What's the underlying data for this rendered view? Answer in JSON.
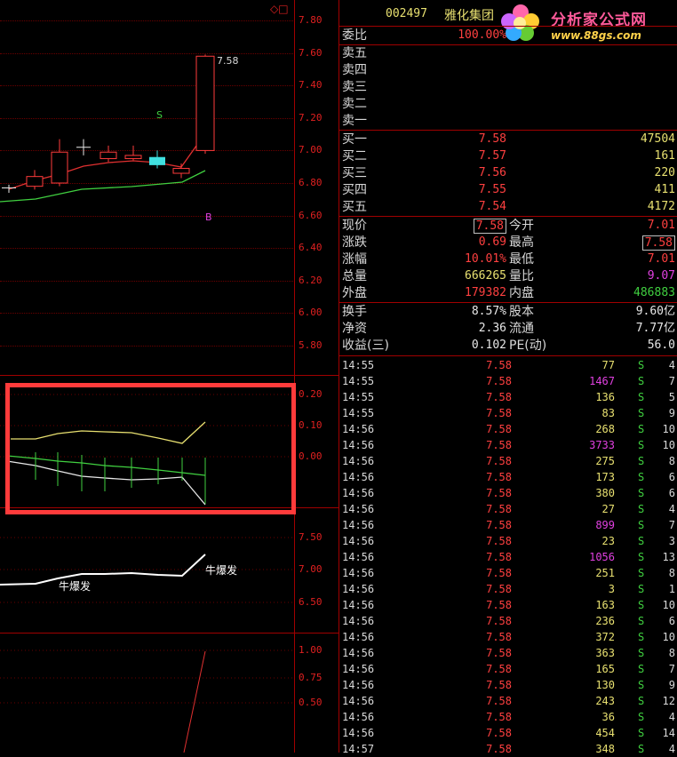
{
  "chart": {
    "price_axis": [
      "7.80",
      "7.60",
      "7.40",
      "7.20",
      "7.00",
      "6.80",
      "6.60",
      "6.40",
      "6.20",
      "6.00",
      "5.80"
    ],
    "ind1_axis": [
      "0.20",
      "0.10",
      "0.00"
    ],
    "ind2_axis": [
      "7.50",
      "7.00",
      "6.50"
    ],
    "ind3_axis": [
      "1.00",
      "0.75",
      "0.50"
    ],
    "high_label": "7.58",
    "marker_s": "S",
    "marker_b": "B",
    "cow_label_1": "牛爆发",
    "cow_label_2": "牛爆发",
    "corner_icons": "◇□",
    "highlight_color": "#ff3b3b"
  },
  "chart_data": {
    "type": "candlestick",
    "candles": [
      {
        "open": 6.77,
        "close": 6.77,
        "high": 6.79,
        "low": 6.74
      },
      {
        "open": 6.78,
        "close": 6.84,
        "high": 6.88,
        "low": 6.76
      },
      {
        "open": 6.8,
        "close": 6.99,
        "high": 7.07,
        "low": 6.78
      },
      {
        "open": 7.02,
        "close": 7.02,
        "high": 7.07,
        "low": 6.97
      },
      {
        "open": 6.95,
        "close": 6.99,
        "high": 7.03,
        "low": 6.93
      },
      {
        "open": 6.95,
        "close": 6.97,
        "high": 7.03,
        "low": 6.94
      },
      {
        "open": 6.96,
        "close": 6.91,
        "high": 7.0,
        "low": 6.89
      },
      {
        "open": 6.86,
        "close": 6.89,
        "high": 6.92,
        "low": 6.83
      },
      {
        "open": 7.0,
        "close": 7.58,
        "high": 7.59,
        "low": 6.98
      }
    ],
    "ylim": [
      5.8,
      7.8
    ]
  },
  "quote": {
    "code": "002497",
    "name": "雅化集团",
    "logo_text": "分析家公式网",
    "logo_url": "www.88gs.com",
    "weibi_label": "委比",
    "weibi_value": "100.00%",
    "sells": [
      {
        "label": "卖五",
        "price": "",
        "vol": ""
      },
      {
        "label": "卖四",
        "price": "",
        "vol": ""
      },
      {
        "label": "卖三",
        "price": "",
        "vol": ""
      },
      {
        "label": "卖二",
        "price": "",
        "vol": ""
      },
      {
        "label": "卖一",
        "price": "",
        "vol": ""
      }
    ],
    "buys": [
      {
        "label": "买一",
        "price": "7.58",
        "vol": "47504"
      },
      {
        "label": "买二",
        "price": "7.57",
        "vol": "161"
      },
      {
        "label": "买三",
        "price": "7.56",
        "vol": "220"
      },
      {
        "label": "买四",
        "price": "7.55",
        "vol": "411"
      },
      {
        "label": "买五",
        "price": "7.54",
        "vol": "4172"
      }
    ],
    "stats": [
      {
        "l1": "现价",
        "v1": "7.58",
        "c1": "red",
        "l2": "今开",
        "v2": "7.01",
        "c2": "red"
      },
      {
        "l1": "涨跌",
        "v1": "0.69",
        "c1": "red",
        "l2": "最高",
        "v2": "7.58",
        "c2": "red"
      },
      {
        "l1": "涨幅",
        "v1": "10.01%",
        "c1": "red",
        "l2": "最低",
        "v2": "7.01",
        "c2": "red"
      },
      {
        "l1": "总量",
        "v1": "666265",
        "c1": "yel",
        "l2": "量比",
        "v2": "9.07",
        "c2": "mag"
      },
      {
        "l1": "外盘",
        "v1": "179382",
        "c1": "red",
        "l2": "内盘",
        "v2": "486883",
        "c2": "grn"
      }
    ],
    "fund": [
      {
        "l1": "换手",
        "v1": "8.57%",
        "l2": "股本",
        "v2": "9.60亿"
      },
      {
        "l1": "净资",
        "v1": "2.36",
        "l2": "流通",
        "v2": "7.77亿"
      },
      {
        "l1": "收益(三)",
        "v1": "0.102",
        "l2": "PE(动)",
        "v2": "56.0"
      }
    ]
  },
  "trades": [
    {
      "t": "14:55",
      "p": "7.58",
      "v": "77",
      "c": "yel",
      "s": "S",
      "n": "4"
    },
    {
      "t": "14:55",
      "p": "7.58",
      "v": "1467",
      "c": "mag",
      "s": "S",
      "n": "7"
    },
    {
      "t": "14:55",
      "p": "7.58",
      "v": "136",
      "c": "yel",
      "s": "S",
      "n": "5"
    },
    {
      "t": "14:55",
      "p": "7.58",
      "v": "83",
      "c": "yel",
      "s": "S",
      "n": "9"
    },
    {
      "t": "14:56",
      "p": "7.58",
      "v": "268",
      "c": "yel",
      "s": "S",
      "n": "10"
    },
    {
      "t": "14:56",
      "p": "7.58",
      "v": "3733",
      "c": "mag",
      "s": "S",
      "n": "10"
    },
    {
      "t": "14:56",
      "p": "7.58",
      "v": "275",
      "c": "yel",
      "s": "S",
      "n": "8"
    },
    {
      "t": "14:56",
      "p": "7.58",
      "v": "173",
      "c": "yel",
      "s": "S",
      "n": "6"
    },
    {
      "t": "14:56",
      "p": "7.58",
      "v": "380",
      "c": "yel",
      "s": "S",
      "n": "6"
    },
    {
      "t": "14:56",
      "p": "7.58",
      "v": "27",
      "c": "yel",
      "s": "S",
      "n": "4"
    },
    {
      "t": "14:56",
      "p": "7.58",
      "v": "899",
      "c": "mag",
      "s": "S",
      "n": "7"
    },
    {
      "t": "14:56",
      "p": "7.58",
      "v": "23",
      "c": "yel",
      "s": "S",
      "n": "3"
    },
    {
      "t": "14:56",
      "p": "7.58",
      "v": "1056",
      "c": "mag",
      "s": "S",
      "n": "13"
    },
    {
      "t": "14:56",
      "p": "7.58",
      "v": "251",
      "c": "yel",
      "s": "S",
      "n": "8"
    },
    {
      "t": "14:56",
      "p": "7.58",
      "v": "3",
      "c": "yel",
      "s": "S",
      "n": "1"
    },
    {
      "t": "14:56",
      "p": "7.58",
      "v": "163",
      "c": "yel",
      "s": "S",
      "n": "10"
    },
    {
      "t": "14:56",
      "p": "7.58",
      "v": "236",
      "c": "yel",
      "s": "S",
      "n": "6"
    },
    {
      "t": "14:56",
      "p": "7.58",
      "v": "372",
      "c": "yel",
      "s": "S",
      "n": "10"
    },
    {
      "t": "14:56",
      "p": "7.58",
      "v": "363",
      "c": "yel",
      "s": "S",
      "n": "8"
    },
    {
      "t": "14:56",
      "p": "7.58",
      "v": "165",
      "c": "yel",
      "s": "S",
      "n": "7"
    },
    {
      "t": "14:56",
      "p": "7.58",
      "v": "130",
      "c": "yel",
      "s": "S",
      "n": "9"
    },
    {
      "t": "14:56",
      "p": "7.58",
      "v": "243",
      "c": "yel",
      "s": "S",
      "n": "12"
    },
    {
      "t": "14:56",
      "p": "7.58",
      "v": "36",
      "c": "yel",
      "s": "S",
      "n": "4"
    },
    {
      "t": "14:56",
      "p": "7.58",
      "v": "454",
      "c": "yel",
      "s": "S",
      "n": "14"
    },
    {
      "t": "14:57",
      "p": "7.58",
      "v": "348",
      "c": "yel",
      "s": "S",
      "n": "4"
    }
  ]
}
